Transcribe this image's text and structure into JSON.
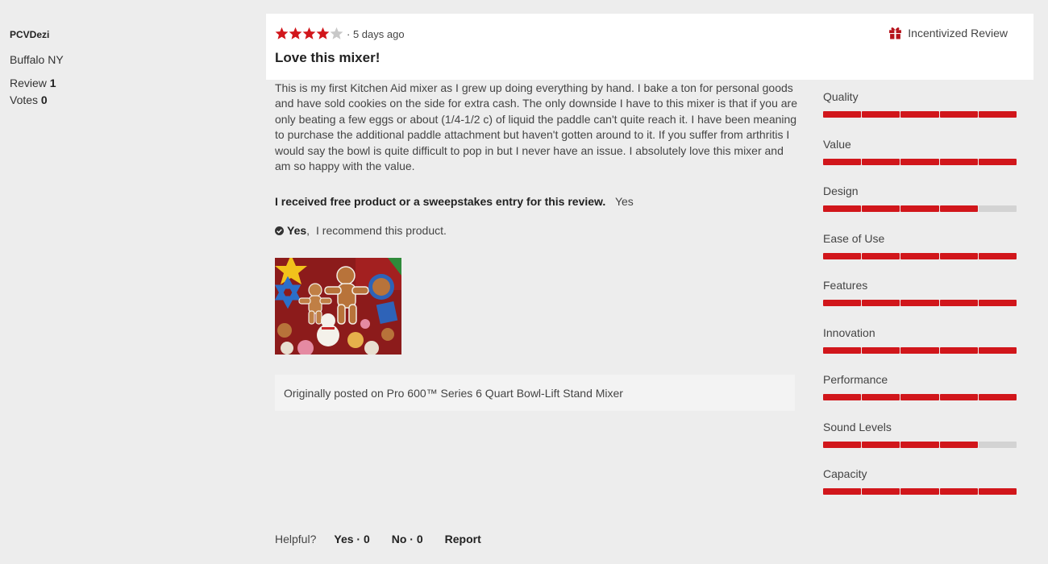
{
  "author": {
    "name": "PCVDezi",
    "location": "Buffalo NY",
    "review_label": "Review",
    "review_count": "1",
    "votes_label": "Votes",
    "votes_count": "0"
  },
  "review": {
    "rating": 4,
    "rating_max": 5,
    "time_ago": "· 5 days ago",
    "title": "Love this mixer!",
    "badge": "Incentivized Review",
    "badge_icon": "gift-icon",
    "body": "This is my first Kitchen Aid mixer as I grew up doing everything by hand. I bake a ton for personal goods and have sold cookies on the side for extra cash. The only downside I have to this mixer is that if you are only beating a few eggs or about (1/4-1/2 c) of liquid the paddle can't quite reach it. I have been meaning to purchase the additional paddle attachment but haven't gotten around to it. If you suffer from arthritis I would say the bowl is quite difficult to pop in but I never have an issue. I absolutely love this mixer and am so happy with the value.",
    "disclosure_question": "I received free product or a sweepstakes entry for this review.",
    "disclosure_answer": "Yes",
    "recommend_yes": "Yes",
    "recommend_text": "I recommend this product.",
    "originally_posted": "Originally posted on Pro 600™ Series 6 Quart Bowl-Lift Stand Mixer"
  },
  "helpful": {
    "label": "Helpful?",
    "yes": "Yes · 0",
    "no": "No · 0",
    "report": "Report"
  },
  "ratings": [
    {
      "name": "Quality",
      "value": 5,
      "max": 5
    },
    {
      "name": "Value",
      "value": 5,
      "max": 5
    },
    {
      "name": "Design",
      "value": 4,
      "max": 5
    },
    {
      "name": "Ease of Use",
      "value": 5,
      "max": 5
    },
    {
      "name": "Features",
      "value": 5,
      "max": 5
    },
    {
      "name": "Innovation",
      "value": 5,
      "max": 5
    },
    {
      "name": "Performance",
      "value": 5,
      "max": 5
    },
    {
      "name": "Sound Levels",
      "value": 4,
      "max": 5
    },
    {
      "name": "Capacity",
      "value": 5,
      "max": 5
    }
  ],
  "colors": {
    "accent_red": "#d1161b",
    "star_empty": "#c8c8c8",
    "bar_empty": "#d3d3d3"
  }
}
